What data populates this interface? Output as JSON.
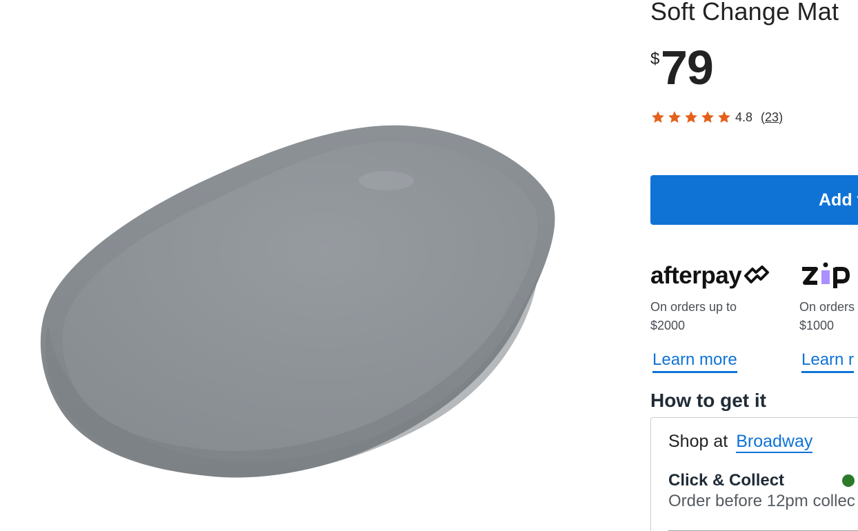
{
  "product": {
    "title": "Soft Change Mat",
    "price_currency": "$",
    "price_value": "79",
    "image_alt": "grey-change-mat-image"
  },
  "rating": {
    "value": "4.8",
    "count": "23",
    "stars": 5,
    "star_color": "#e3611c"
  },
  "actions": {
    "add_label": "Add t"
  },
  "payments": [
    {
      "name": "afterpay",
      "logo_text": "afterpay",
      "text": "On orders up to",
      "amount": "$2000",
      "link": "Learn more"
    },
    {
      "name": "zip",
      "logo_text": "Zip",
      "text": "On orders",
      "amount": "$1000",
      "link": "Learn r"
    }
  ],
  "fulfilment": {
    "heading": "How to get it",
    "shop_at_label": "Shop at",
    "store_name": "Broadway",
    "click_collect_title": "Click & Collect",
    "click_collect_text": "Order before 12pm collec",
    "status_color": "#2a7a2a"
  },
  "colors": {
    "accent": "#0f73d6",
    "text": "#1f2b36",
    "mat": "#8a8f94"
  }
}
